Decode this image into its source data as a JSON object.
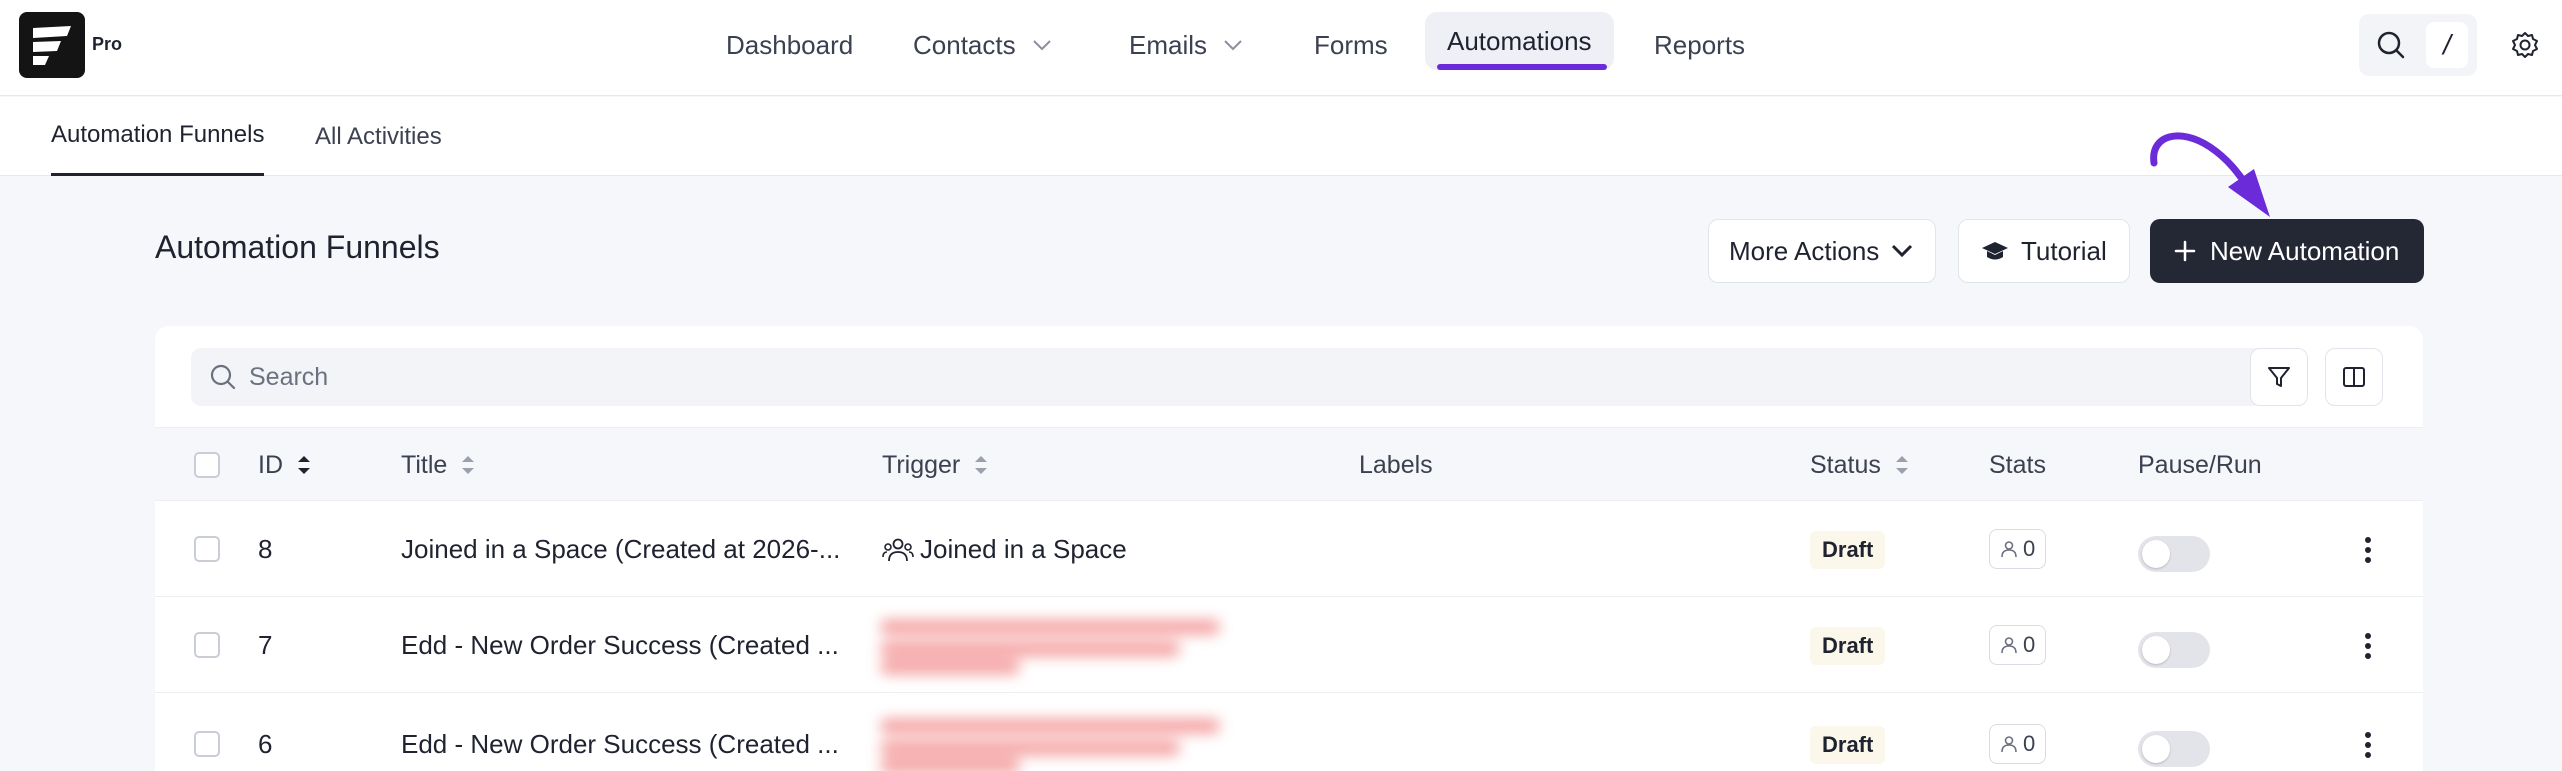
{
  "brand": {
    "badge": "Pro"
  },
  "nav": {
    "items": [
      {
        "label": "Dashboard"
      },
      {
        "label": "Contacts"
      },
      {
        "label": "Emails"
      },
      {
        "label": "Forms"
      },
      {
        "label": "Automations"
      },
      {
        "label": "Reports"
      }
    ],
    "active": "Automations",
    "shortcut_key": "/"
  },
  "subtabs": [
    {
      "label": "Automation Funnels"
    },
    {
      "label": "All Activities"
    }
  ],
  "page": {
    "title": "Automation Funnels",
    "more_actions_label": "More Actions",
    "tutorial_label": "Tutorial",
    "new_automation_label": "New Automation"
  },
  "search": {
    "placeholder": "Search",
    "value": ""
  },
  "table": {
    "columns": {
      "id": "ID",
      "title": "Title",
      "trigger": "Trigger",
      "labels": "Labels",
      "status": "Status",
      "stats": "Stats",
      "pause_run": "Pause/Run"
    },
    "rows": [
      {
        "id": "8",
        "title": "Joined in a Space (Created at 2026-...",
        "trigger": "Joined in a Space",
        "trigger_hidden": false,
        "status": "Draft",
        "stats": "0"
      },
      {
        "id": "7",
        "title": "Edd - New Order Success (Created ...",
        "trigger": "",
        "trigger_hidden": true,
        "status": "Draft",
        "stats": "0"
      },
      {
        "id": "6",
        "title": "Edd - New Order Success (Created ...",
        "trigger": "",
        "trigger_hidden": true,
        "status": "Draft",
        "stats": "0"
      }
    ]
  },
  "colors": {
    "accent": "#6c2bd9",
    "primary_button": "#242834",
    "draft_badge_bg": "#fbf7ea",
    "toggle_off": "#e2e4e9"
  },
  "icons": {
    "search": "search-icon",
    "settings": "gear-icon",
    "filter": "filter-icon",
    "columns": "columns-icon",
    "tutorial": "graduation-cap-icon",
    "add": "plus-icon",
    "stats": "user-icon",
    "row_menu": "kebab-icon"
  }
}
